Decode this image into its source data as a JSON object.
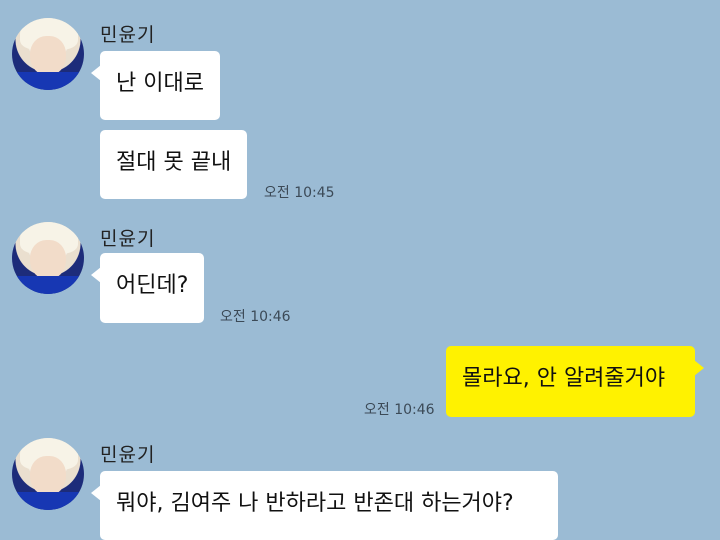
{
  "messages": {
    "group1": {
      "sender": "민윤기",
      "bubble1": "난 이대로",
      "bubble2": "절대 못 끝내",
      "time": "오전 10:45"
    },
    "group2": {
      "sender": "민윤기",
      "bubble1": "어딘데?",
      "time": "오전 10:46"
    },
    "mine": {
      "bubble1": "몰라요, 안 알려줄거야",
      "time": "오전 10:46"
    },
    "group3": {
      "sender": "민윤기",
      "bubble1": "뭐야, 김여주 나 반하라고 반존대 하는거야?"
    }
  },
  "colors": {
    "background": "#9bbbd4",
    "incoming_bubble": "#ffffff",
    "outgoing_bubble": "#fff200"
  }
}
